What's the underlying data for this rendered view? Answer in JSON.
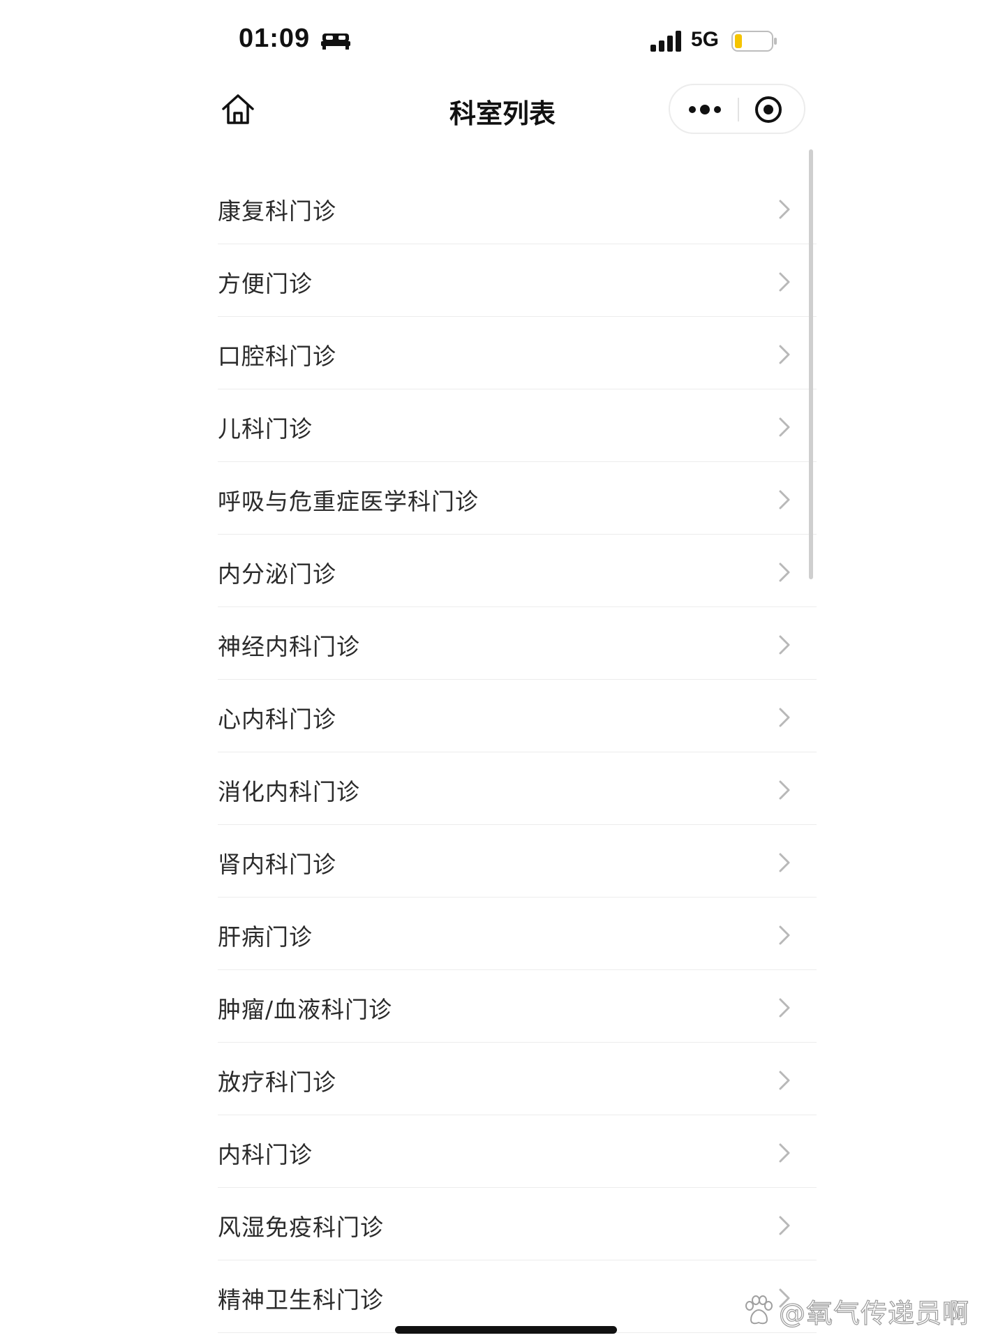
{
  "status_bar": {
    "time": "01:09",
    "network": "5G",
    "icons": [
      "bed-icon",
      "signal-icon",
      "battery-icon"
    ],
    "battery_color": "#f5c400"
  },
  "nav": {
    "title": "科室列表",
    "icons": [
      "home-icon",
      "more-icon",
      "target-icon"
    ]
  },
  "departments": [
    {
      "label": "康复科门诊"
    },
    {
      "label": "方便门诊"
    },
    {
      "label": "口腔科门诊"
    },
    {
      "label": "儿科门诊"
    },
    {
      "label": "呼吸与危重症医学科门诊"
    },
    {
      "label": "内分泌门诊"
    },
    {
      "label": "神经内科门诊"
    },
    {
      "label": "心内科门诊"
    },
    {
      "label": "消化内科门诊"
    },
    {
      "label": "肾内科门诊"
    },
    {
      "label": "肝病门诊"
    },
    {
      "label": "肿瘤/血液科门诊"
    },
    {
      "label": "放疗科门诊"
    },
    {
      "label": "内科门诊"
    },
    {
      "label": "风湿免疫科门诊"
    },
    {
      "label": "精神卫生科门诊"
    }
  ],
  "watermark": {
    "text": "@氧气传递员啊",
    "icon": "paw-icon"
  }
}
